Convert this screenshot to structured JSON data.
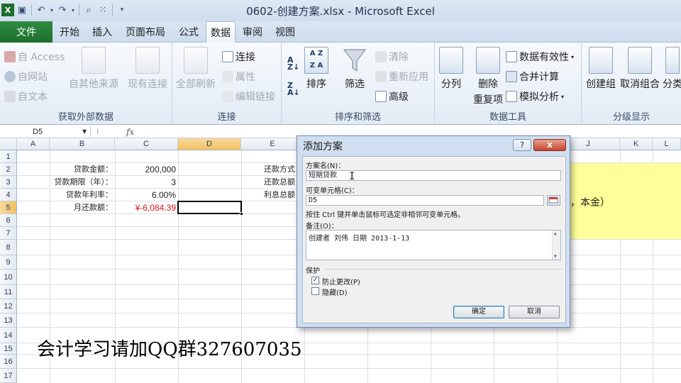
{
  "window": {
    "title": "0602-创建方案.xlsx - Microsoft Excel"
  },
  "qat": {
    "icons": [
      "excel-logo-icon",
      "save-icon",
      "undo-icon",
      "redo-icon",
      "print-preview-icon",
      "select-icon",
      "customize-icon"
    ]
  },
  "tabs": [
    {
      "label": "文件"
    },
    {
      "label": "开始"
    },
    {
      "label": "插入"
    },
    {
      "label": "页面布局"
    },
    {
      "label": "公式"
    },
    {
      "label": "数据"
    },
    {
      "label": "审阅"
    },
    {
      "label": "视图"
    }
  ],
  "ribbon": {
    "external": {
      "label": "获取外部数据",
      "access": "自 Access",
      "web": "自网站",
      "text": "自文本",
      "other": "自其他来源",
      "existing": "现有连接"
    },
    "connections": {
      "label": "连接",
      "refresh_all": "全部刷新",
      "connections": "连接",
      "properties": "属性",
      "edit_links": "编辑链接"
    },
    "sort_filter": {
      "label": "排序和筛选",
      "sort": "排序",
      "filter": "筛选",
      "clear": "清除",
      "reapply": "重新应用",
      "advanced": "高级"
    },
    "data_tools": {
      "label": "数据工具",
      "text_to_columns": "分列",
      "remove_duplicates": "删除",
      "remove_duplicates_2": "重复项",
      "validation": "数据有效性",
      "consolidate": "合并计算",
      "what_if": "模拟分析"
    },
    "outline": {
      "label": "分级显示",
      "group": "创建组",
      "ungroup": "取消组合",
      "subtotal": "分类"
    }
  },
  "formula_bar": {
    "name_box": "D5",
    "fx": "fx",
    "content": ""
  },
  "grid": {
    "columns": [
      "A",
      "B",
      "C",
      "D",
      "E",
      "F",
      "G",
      "H",
      "I",
      "J",
      "K",
      "L"
    ],
    "rows": [
      "1",
      "2",
      "3",
      "4",
      "5",
      "6",
      "7",
      "8",
      "9",
      "10",
      "11",
      "12",
      "13",
      "14",
      "15",
      "16",
      "17"
    ],
    "cells": {
      "B2": "贷款金额：",
      "C2": "200,000",
      "B3": "贷款期限（年）：",
      "C3": "3",
      "B4": "贷款年利率：",
      "C4": "6.00%",
      "B5": "月还款额：",
      "C5": "¥-6,084.39",
      "E2": "还款方式：",
      "E3": "还款总额：",
      "E4": "利息总额：",
      "J4": "限，本金）"
    },
    "selected_cell": "D5"
  },
  "dialog": {
    "title": "添加方案",
    "help": "?",
    "close": "x",
    "name_label": "方案名(N)：",
    "name_value": "短期贷款",
    "cells_label": "可变单元格(C)：",
    "cells_value": "D5",
    "hint": "按住 Ctrl 键并单击鼠标可选定非相邻可变单元格。",
    "comment_label": "备注(O)：",
    "comment_value": "创建者 刘伟 日期 2013-1-13",
    "protection_label": "保护",
    "prevent_changes": "防止更改(P)",
    "prevent_changes_checked": true,
    "hide": "隐藏(D)",
    "hide_checked": false,
    "ok": "确定",
    "cancel": "取消"
  },
  "watermark": "会计学习请加QQ群327607035",
  "colors": {
    "file_tab": "#1d6e2d",
    "selected_header": "#f1c15f",
    "negative": "#e0101a",
    "highlight": "#ffff99"
  }
}
